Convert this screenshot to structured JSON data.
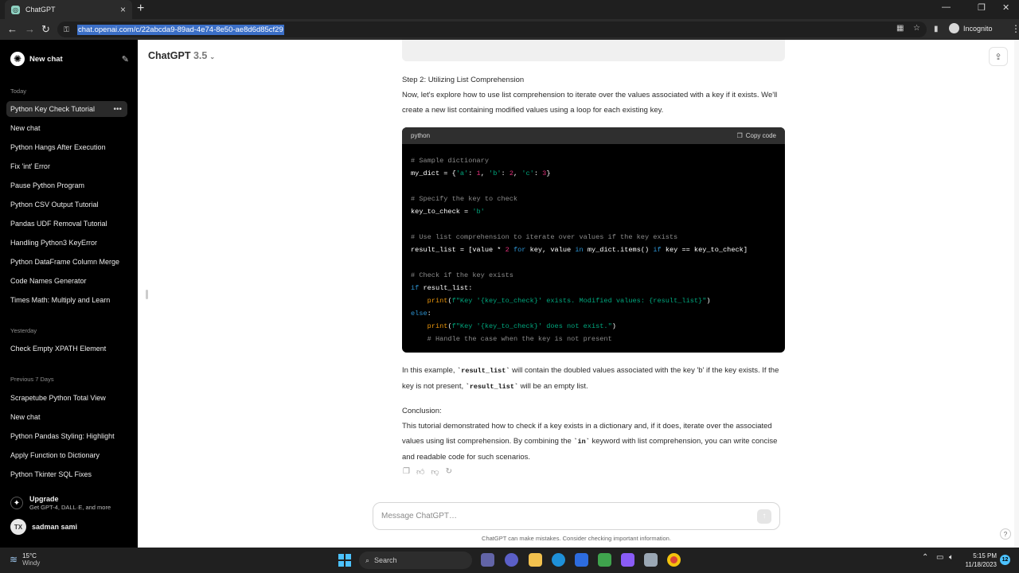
{
  "browser": {
    "tab_title": "ChatGPT",
    "url": "chat.openai.com/c/22abcda9-89ad-4e74-8e50-ae8d6d85cf29",
    "profile_label": "Incognito"
  },
  "sidebar": {
    "new_chat_label": "New chat",
    "sections": [
      {
        "label": "Today",
        "items": [
          {
            "label": "Python Key Check Tutorial",
            "active": true
          },
          {
            "label": "New chat"
          },
          {
            "label": "Python Hangs After Execution"
          },
          {
            "label": "Fix 'int' Error"
          },
          {
            "label": "Pause Python Program"
          },
          {
            "label": "Python CSV Output Tutorial"
          },
          {
            "label": "Pandas UDF Removal Tutorial"
          },
          {
            "label": "Handling Python3 KeyError"
          },
          {
            "label": "Python DataFrame Column Merge"
          },
          {
            "label": "Code Names Generator"
          },
          {
            "label": "Times Math: Multiply and Learn"
          }
        ]
      },
      {
        "label": "Yesterday",
        "items": [
          {
            "label": "Check Empty XPATH Element"
          }
        ]
      },
      {
        "label": "Previous 7 Days",
        "items": [
          {
            "label": "Scrapetube Python Total View"
          },
          {
            "label": "New chat"
          },
          {
            "label": "Python Pandas Styling: Highlight"
          },
          {
            "label": "Apply Function to Dictionary"
          },
          {
            "label": "Python Tkinter SQL Fixes"
          }
        ]
      }
    ],
    "upgrade": {
      "title": "Upgrade",
      "subtitle": "Get GPT-4, DALL·E, and more"
    },
    "user": {
      "initials": "TX",
      "name": "sadman sami"
    }
  },
  "header": {
    "model_name": "ChatGPT",
    "model_version": "3.5"
  },
  "message": {
    "step_heading": "Step 2: Utilizing List Comprehension",
    "step_text": "Now, let's explore how to use list comprehension to iterate over the values associated with a key if it exists. We'll create a new list containing modified values using a loop for each existing key.",
    "code": {
      "language": "python",
      "copy_label": "Copy code"
    },
    "explain_prefix": "In this example, ",
    "explain_code_1": "`result_list`",
    "explain_mid": " will contain the doubled values associated with the key 'b' if the key exists. If the key is not present, ",
    "explain_code_2": "`result_list`",
    "explain_suffix": " will be an empty list.",
    "conclusion_heading": "Conclusion:",
    "conclusion_prefix": "This tutorial demonstrated how to check if a key exists in a dictionary and, if it does, iterate over the associated values using list comprehension. By combining the ",
    "conclusion_code": "`in`",
    "conclusion_suffix": " keyword with list comprehension, you can write concise and readable code for such scenarios."
  },
  "composer": {
    "placeholder": "Message ChatGPT…"
  },
  "disclaimer": "ChatGPT can make mistakes. Consider checking important information.",
  "taskbar": {
    "temperature": "15°C",
    "condition": "Windy",
    "search_label": "Search",
    "time": "5:15 PM",
    "date": "11/18/2023",
    "notification_count": "12"
  },
  "colors": {
    "sidebar_bg": "#000000",
    "code_bg": "#000000",
    "code_header_bg": "#2f2f2f",
    "string": "#00a67d",
    "number": "#df3079",
    "keyword": "#2e95d3",
    "function": "#e9950c",
    "comment": "#8b8b8b"
  }
}
